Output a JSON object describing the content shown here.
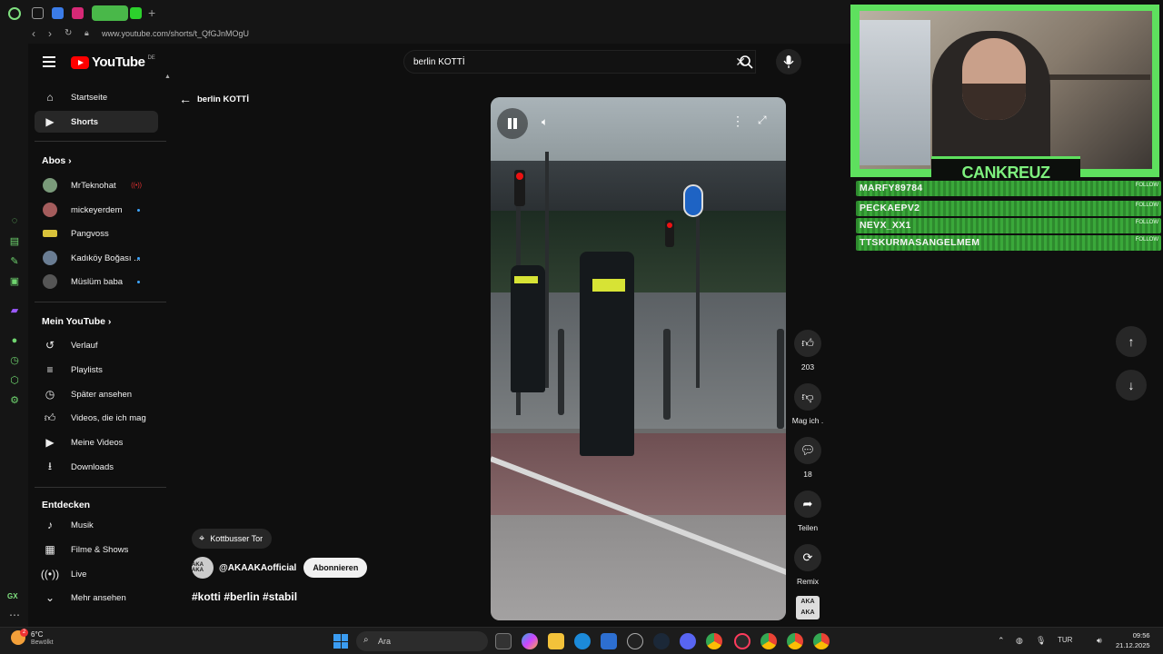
{
  "browser": {
    "url": "www.youtube.com/shorts/t_QfGJnMOgU"
  },
  "youtube": {
    "logo_text": "YouTube",
    "region": "DE",
    "search": {
      "query": "berlin KOTTİ"
    }
  },
  "sidebar": {
    "top_items": [
      {
        "label": "Startseite",
        "icon": "home-icon"
      },
      {
        "label": "Shorts",
        "icon": "shorts-icon",
        "selected": true
      }
    ],
    "subscriptions_heading": "Abos",
    "subscriptions": [
      {
        "label": "MrTeknohat",
        "status": "live"
      },
      {
        "label": "mickeyerdem",
        "status": "new"
      },
      {
        "label": "Pangvoss",
        "status": ""
      },
      {
        "label": "Kadıköy Boğası ...",
        "status": "new"
      },
      {
        "label": "Müslüm baba",
        "status": "new"
      }
    ],
    "my_youtube_heading": "Mein YouTube",
    "my_youtube": [
      {
        "label": "Verlauf",
        "icon": "history-icon"
      },
      {
        "label": "Playlists",
        "icon": "playlist-icon"
      },
      {
        "label": "Später ansehen",
        "icon": "clock-icon"
      },
      {
        "label": "Videos, die ich mag",
        "icon": "thumbs-up-icon"
      },
      {
        "label": "Meine Videos",
        "icon": "video-icon"
      },
      {
        "label": "Downloads",
        "icon": "download-icon"
      }
    ],
    "explore_heading": "Entdecken",
    "explore": [
      {
        "label": "Musik",
        "icon": "music-icon"
      },
      {
        "label": "Filme & Shows",
        "icon": "film-icon"
      },
      {
        "label": "Live",
        "icon": "live-icon"
      },
      {
        "label": "Mehr ansehen",
        "icon": "chevron-down-icon"
      }
    ]
  },
  "shorts": {
    "back_query": "berlin KOTTİ",
    "location": "Kottbusser Tor",
    "channel": "@AKAAKAofficial",
    "channel_avatar_text": "AKA AKA",
    "subscribe_label": "Abonnieren",
    "caption": "#kotti #berlin #stabil",
    "actions": {
      "likes": "203",
      "dislike_label": "Mag ich .",
      "comments": "18",
      "share_label": "Teilen",
      "remix_label": "Remix"
    }
  },
  "stream_overlay": {
    "streamer": "CANKREUZ",
    "follows": [
      {
        "name": "MARFY89784",
        "action": "FOLLOW"
      },
      {
        "name": "PECKAEPV2",
        "action": "FOLLOW"
      },
      {
        "name": "NEVX_XX1",
        "action": "FOLLOW"
      },
      {
        "name": "TTSKURMASANGELMEM",
        "action": "FOLLOW"
      }
    ]
  },
  "taskbar": {
    "weather_temp": "6°C",
    "weather_cond": "Bewölkt",
    "notification_count": "2",
    "search_placeholder": "Ara",
    "lang": "TUR",
    "time": "09:56",
    "date": "21.12.2025"
  },
  "colors": {
    "accent_green": "#5ee05e",
    "yt_red": "#ff0000",
    "bg": "#0f0f0f"
  }
}
